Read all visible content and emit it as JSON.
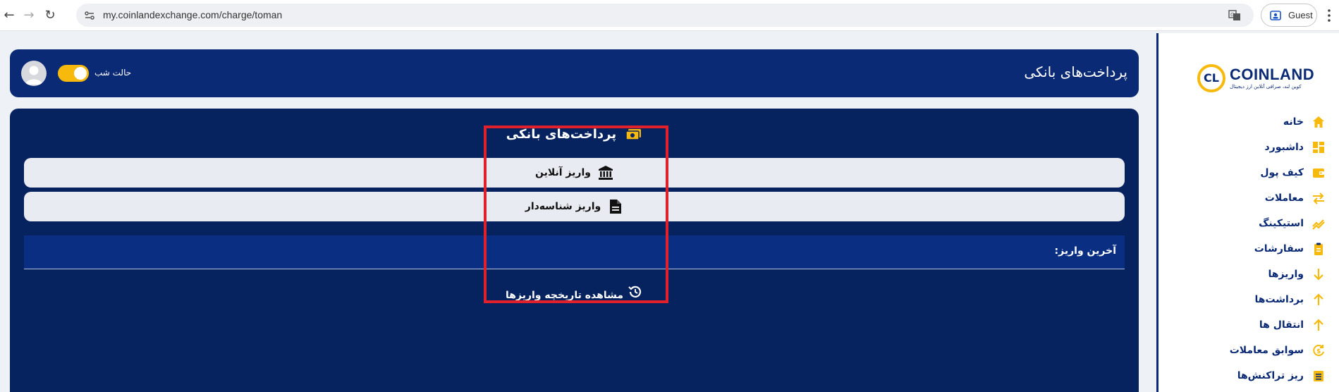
{
  "browser": {
    "url": "my.coinlandexchange.com/charge/toman",
    "profile_label": "Guest",
    "icons": [
      "back-icon",
      "forward-icon",
      "reload-icon",
      "site-info-icon",
      "translate-icon",
      "profile-icon",
      "more-icon"
    ]
  },
  "brand": {
    "name": "COINLAND",
    "tagline": "کوین لند، صرافی آنلاین ارز دیجیتال",
    "accent": "#f6b90c",
    "primary": "#0b2a75"
  },
  "sidebar": {
    "items": [
      {
        "label": "خانه",
        "icon": "home-icon"
      },
      {
        "label": "داشبورد",
        "icon": "dashboard-icon"
      },
      {
        "label": "کیف پول",
        "icon": "wallet-icon"
      },
      {
        "label": "معاملات",
        "icon": "swap-icon"
      },
      {
        "label": "استیکینگ",
        "icon": "trend-icon"
      },
      {
        "label": "سفارشات",
        "icon": "clipboard-icon"
      },
      {
        "label": "واریزها",
        "icon": "arrow-down-icon"
      },
      {
        "label": "برداشت‌ها",
        "icon": "arrow-up-icon"
      },
      {
        "label": "انتقال ها",
        "icon": "arrow-up-icon"
      },
      {
        "label": "سوابق معاملات",
        "icon": "history-exchange-icon"
      },
      {
        "label": "ریز تراکنش‌ها",
        "icon": "list-icon"
      }
    ]
  },
  "header": {
    "title": "پرداخت‌های بانکی",
    "night_mode_label": "حالت شب",
    "night_mode_on": true
  },
  "main": {
    "card_title": "پرداخت‌های بانکی",
    "online_deposit_label": "واریز آنلاین",
    "id_deposit_label": "واریز شناسه‌دار",
    "latest_deposit_label": "آخرین واریز:",
    "history_link_label": "مشاهده تاریخچه واریزها"
  }
}
